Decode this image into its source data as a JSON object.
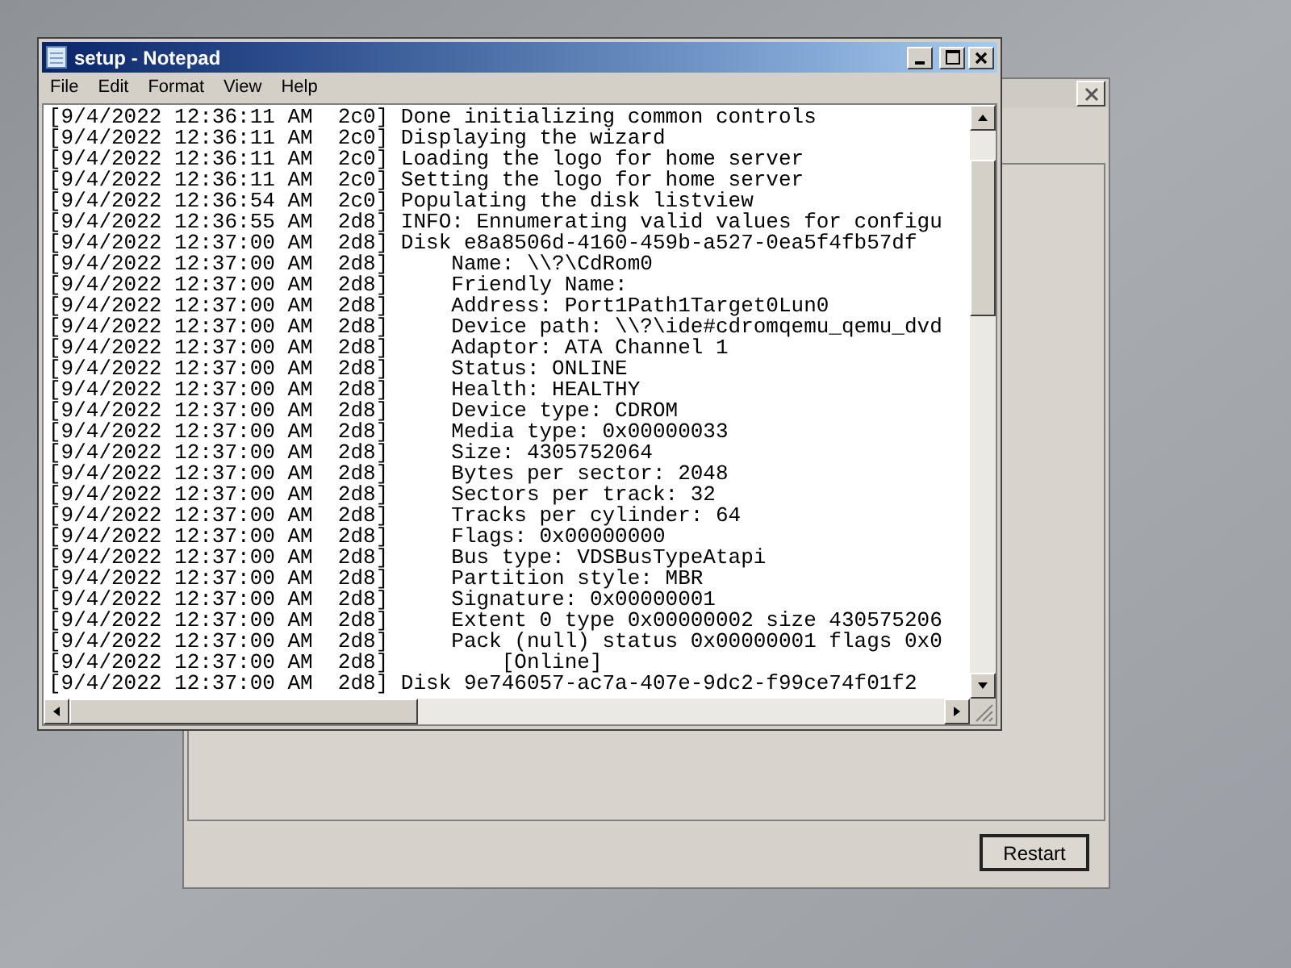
{
  "background_window": {
    "button": "Restart"
  },
  "notepad": {
    "title": "setup - Notepad",
    "menu": [
      "File",
      "Edit",
      "Format",
      "View",
      "Help"
    ],
    "lines": [
      "[9/4/2022 12:36:11 AM  2c0] Done initializing common controls",
      "[9/4/2022 12:36:11 AM  2c0] Displaying the wizard",
      "[9/4/2022 12:36:11 AM  2c0] Loading the logo for home server",
      "[9/4/2022 12:36:11 AM  2c0] Setting the logo for home server",
      "[9/4/2022 12:36:54 AM  2c0] Populating the disk listview",
      "[9/4/2022 12:36:55 AM  2d8] INFO: Ennumerating valid values for configu",
      "[9/4/2022 12:37:00 AM  2d8] Disk e8a8506d-4160-459b-a527-0ea5f4fb57df",
      "[9/4/2022 12:37:00 AM  2d8]     Name: \\\\?\\CdRom0",
      "[9/4/2022 12:37:00 AM  2d8]     Friendly Name:",
      "[9/4/2022 12:37:00 AM  2d8]     Address: Port1Path1Target0Lun0",
      "[9/4/2022 12:37:00 AM  2d8]     Device path: \\\\?\\ide#cdromqemu_qemu_dvd",
      "[9/4/2022 12:37:00 AM  2d8]     Adaptor: ATA Channel 1",
      "[9/4/2022 12:37:00 AM  2d8]     Status: ONLINE",
      "[9/4/2022 12:37:00 AM  2d8]     Health: HEALTHY",
      "[9/4/2022 12:37:00 AM  2d8]     Device type: CDROM",
      "[9/4/2022 12:37:00 AM  2d8]     Media type: 0x00000033",
      "[9/4/2022 12:37:00 AM  2d8]     Size: 4305752064",
      "[9/4/2022 12:37:00 AM  2d8]     Bytes per sector: 2048",
      "[9/4/2022 12:37:00 AM  2d8]     Sectors per track: 32",
      "[9/4/2022 12:37:00 AM  2d8]     Tracks per cylinder: 64",
      "[9/4/2022 12:37:00 AM  2d8]     Flags: 0x00000000",
      "[9/4/2022 12:37:00 AM  2d8]     Bus type: VDSBusTypeAtapi",
      "[9/4/2022 12:37:00 AM  2d8]     Partition style: MBR",
      "[9/4/2022 12:37:00 AM  2d8]     Signature: 0x00000001",
      "[9/4/2022 12:37:00 AM  2d8]     Extent 0 type 0x00000002 size 430575206",
      "[9/4/2022 12:37:00 AM  2d8]     Pack (null) status 0x00000001 flags 0x0",
      "[9/4/2022 12:37:00 AM  2d8]         [Online]",
      "[9/4/2022 12:37:00 AM  2d8] Disk 9e746057-ac7a-407e-9dc2-f99ce74f01f2"
    ]
  }
}
